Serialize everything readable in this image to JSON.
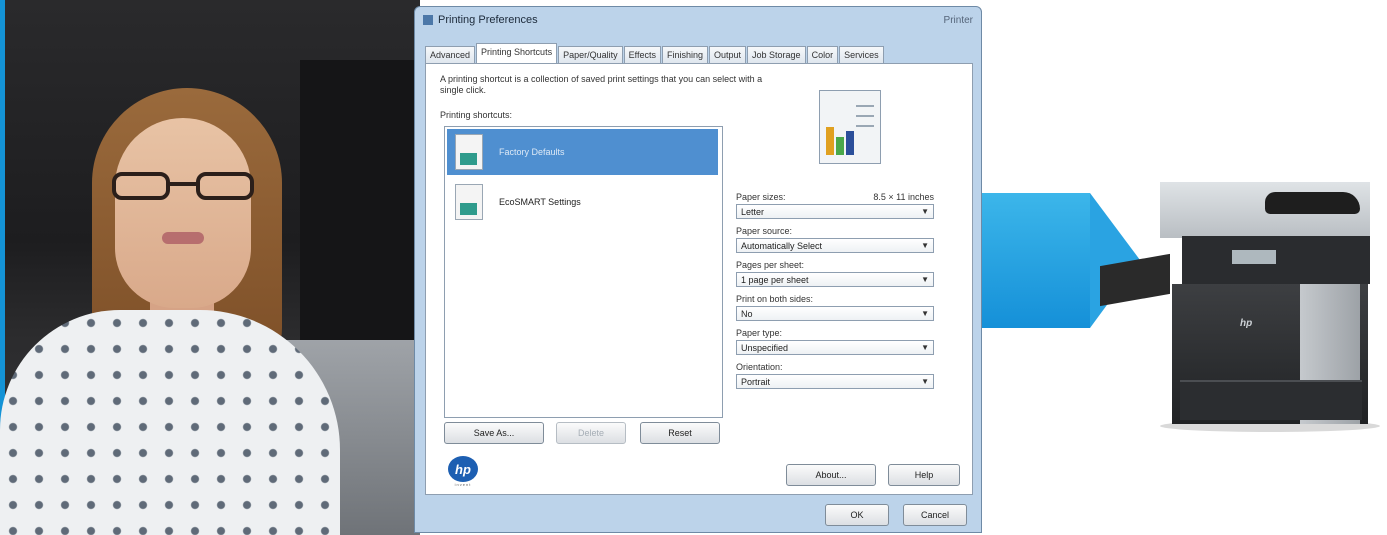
{
  "dialog": {
    "title": "Printing Preferences",
    "title_right": "Printer",
    "tabs": [
      {
        "label": "Advanced"
      },
      {
        "label": "Printing Shortcuts"
      },
      {
        "label": "Paper/Quality"
      },
      {
        "label": "Effects"
      },
      {
        "label": "Finishing"
      },
      {
        "label": "Output"
      },
      {
        "label": "Job Storage"
      },
      {
        "label": "Color"
      },
      {
        "label": "Services"
      }
    ],
    "description": "A printing shortcut is a collection of saved print settings that you can select with a single click.",
    "shortcuts_label": "Printing shortcuts:",
    "shortcuts": [
      {
        "label": "Factory Defaults"
      },
      {
        "label": "EcoSMART Settings"
      }
    ],
    "settings": {
      "paper_sizes": {
        "label": "Paper sizes:",
        "size": "8.5 × 11 inches",
        "value": "Letter"
      },
      "paper_source": {
        "label": "Paper source:",
        "value": "Automatically Select"
      },
      "pages_per_sheet": {
        "label": "Pages per sheet:",
        "value": "1 page per sheet"
      },
      "print_both_sides": {
        "label": "Print on both sides:",
        "value": "No"
      },
      "paper_type": {
        "label": "Paper type:",
        "value": "Unspecified"
      },
      "orientation": {
        "label": "Orientation:",
        "value": "Portrait"
      }
    },
    "buttons": {
      "save_as": "Save As...",
      "delete": "Delete",
      "reset": "Reset",
      "about": "About...",
      "help": "Help",
      "ok": "OK",
      "cancel": "Cancel"
    },
    "brand": {
      "logo_text": "hp",
      "sub": "invent"
    }
  },
  "icons": {
    "preview": "page-preview-icon",
    "shortcut": "document-icon",
    "arrow": "arrow-right-icon",
    "printer": "printer-icon"
  },
  "colors": {
    "accent": "#2aa3e2",
    "selection": "#4f8fd0",
    "dialog_frame": "#bcd3ea"
  }
}
